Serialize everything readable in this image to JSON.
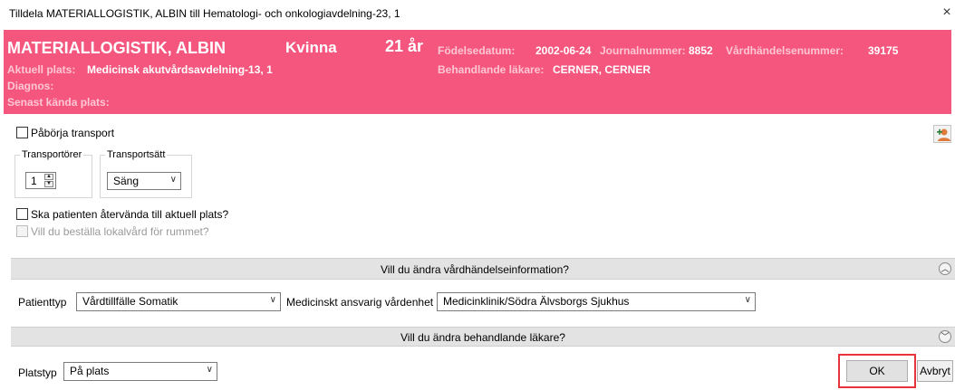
{
  "window": {
    "title": "Tilldela MATERIALLOGISTIK, ALBIN till Hematologi- och onkologiavdelning-23, 1",
    "close_glyph": "×"
  },
  "banner": {
    "name": "MATERIALLOGISTIK, ALBIN",
    "gender": "Kvinna",
    "age": "21 år",
    "dob_label": "Födelsedatum:",
    "dob_value": "2002-06-24",
    "journal_label": "Journalnummer:",
    "journal_value": "8852",
    "encounter_label": "Vårdhändelsenummer:",
    "encounter_value": "39175",
    "current_place_label": "Aktuell plats:",
    "current_place_value": "Medicinsk akutvårdsavdelning-13, 1",
    "physician_label": "Behandlande läkare:",
    "physician_value": "CERNER, CERNER",
    "diagnosis_label": "Diagnos:",
    "last_known_label": "Senast kända plats:",
    "bg_color": "#f4567e"
  },
  "transport": {
    "start_label": "Påbörja transport",
    "transporters_title": "Transportörer",
    "transporters_value": "1",
    "mode_title": "Transportsätt",
    "mode_value": "Säng"
  },
  "options": {
    "return_label": "Ska patienten återvända till aktuell plats?",
    "cleaning_label": "Vill du beställa lokalvård för rummet?"
  },
  "encounter_section": {
    "header": "Vill du ändra vårdhändelseinformation?",
    "patient_type_label": "Patienttyp",
    "patient_type_value": "Vårdtillfälle Somatik",
    "responsible_unit_label": "Medicinskt ansvarig vårdenhet",
    "responsible_unit_value": "Medicinklinik/Södra Älvsborgs Sjukhus"
  },
  "physician_section": {
    "header": "Vill du ändra behandlande läkare?"
  },
  "footer": {
    "place_type_label": "Platstyp",
    "place_type_value": "På plats",
    "ok_label": "OK",
    "cancel_label": "Avbryt",
    "highlight_color": "#e8333c"
  },
  "icons": {
    "collapse": "chevron-up-circle",
    "expand": "chevron-down-circle",
    "person": "person-add-icon"
  }
}
